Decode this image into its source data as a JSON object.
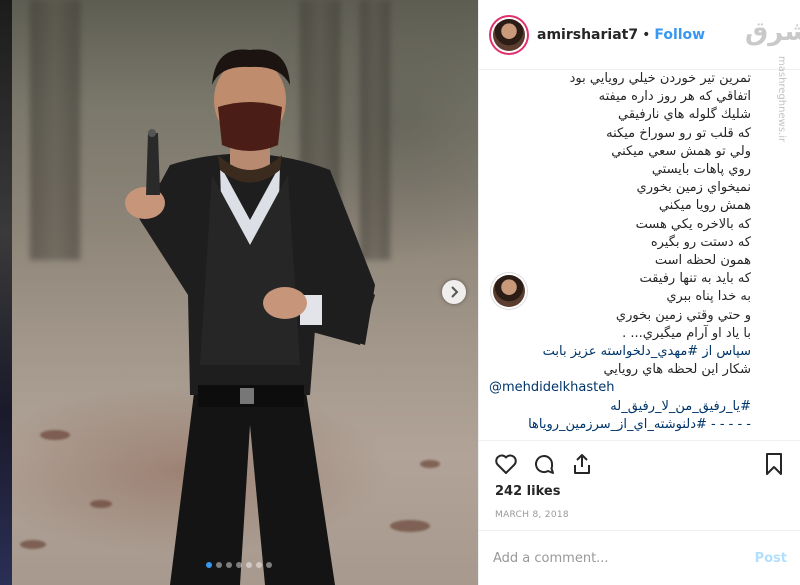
{
  "post": {
    "username": "amirshariat7",
    "separator": "•",
    "follow_label": "Follow",
    "likes": "242 likes",
    "date": "MARCH 8, 2018",
    "add_comment_placeholder": "Add a comment...",
    "post_label": "Post"
  },
  "watermark": {
    "logo": "مشرق",
    "site": "mashreghnews.ir"
  },
  "caption": {
    "lines": [
      "تمرين تير خوردن خيلي رويايي بود",
      "اتفاقي كه هر روز داره ميفته",
      "شليك گلوله هاي نارفيقي",
      "كه قلب تو رو سوراخ ميكنه",
      "ولي تو همش سعي ميكني",
      "روي پاهات بايستي",
      "نميخواي زمين بخوري",
      "همش رويا ميكني",
      "كه بالاخره يكي هست",
      "كه دستت رو بگيره",
      "همون لحظه است",
      "كه بايد به تنها رفيقت",
      "به خدا پناه ببري",
      "و حتي وقتي زمين بخوري",
      "با ياد او آرام ميگيري... .",
      "سپاس از #مهدي_دلخواسته عزيز بابت",
      "شكار اين لحظه هاي رويايي",
      "@mehdidelkhasteh",
      "#يا_رفيق_من_لا_رفيق_له",
      "- - - - - #دلنوشته_اي_از_سرزمين_روياها",
      "."
    ]
  },
  "icons": {
    "like": "heart-icon",
    "comment": "comment-icon",
    "share": "share-icon",
    "save": "bookmark-icon",
    "next": "chevron-right-icon"
  },
  "colors": {
    "accent": "#3897f0",
    "link": "#003569",
    "text": "#262626"
  },
  "carousel": {
    "count": 7,
    "active": 1
  }
}
